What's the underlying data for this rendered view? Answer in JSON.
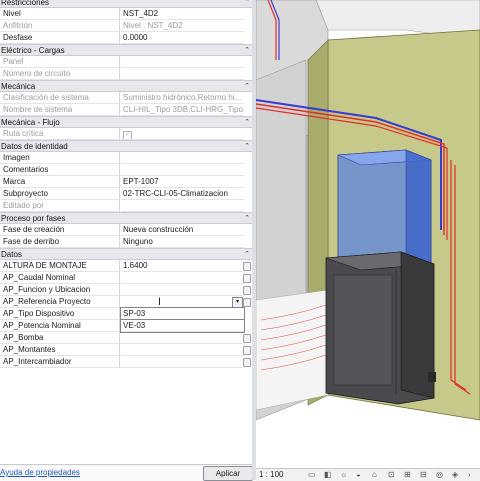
{
  "properties": {
    "groups": [
      {
        "name": "Restricciones",
        "rows": [
          {
            "label": "Nivel",
            "value": "NST_4D2",
            "disabled": false
          },
          {
            "label": "Anfitrión",
            "value": "Nivel : NST_4D2",
            "disabled": true
          },
          {
            "label": "Desfase",
            "value": "0.0000",
            "disabled": false
          }
        ]
      },
      {
        "name": "Eléctrico - Cargas",
        "rows": [
          {
            "label": "Panel",
            "value": "",
            "disabled": true
          },
          {
            "label": "Número de circuito",
            "value": "",
            "disabled": true
          }
        ]
      },
      {
        "name": "Mecánica",
        "rows": [
          {
            "label": "Clasificación de sistema",
            "value": "Suministro hidrónico,Retorno hi...",
            "disabled": true
          },
          {
            "label": "Nombre de sistema",
            "value": "CLI-HIL_Tipo 3DB,CLI-HRG_Tipo...",
            "disabled": true
          }
        ]
      },
      {
        "name": "Mecánica - Flujo",
        "rows": [
          {
            "label": "Ruta crítica",
            "value": "",
            "disabled": true,
            "checkbox": true
          }
        ]
      },
      {
        "name": "Datos de identidad",
        "rows": [
          {
            "label": "Imagen",
            "value": "",
            "disabled": false
          },
          {
            "label": "Comentarios",
            "value": "",
            "disabled": false
          },
          {
            "label": "Marca",
            "value": "EPT-1007",
            "disabled": false
          },
          {
            "label": "Subproyecto",
            "value": "02-TRC-CLI-05-Climatizacion",
            "disabled": false
          },
          {
            "label": "Editado por",
            "value": "",
            "disabled": true
          }
        ]
      },
      {
        "name": "Proceso por fases",
        "rows": [
          {
            "label": "Fase de creación",
            "value": "Nueva construcción",
            "disabled": false
          },
          {
            "label": "Fase de derribo",
            "value": "Ninguno",
            "disabled": false
          }
        ]
      },
      {
        "name": "Datos",
        "rows": [
          {
            "label": "ALTURA DE MONTAJE",
            "value": "1.6400",
            "disabled": false
          },
          {
            "label": "AP_Caudal Nominal",
            "value": "",
            "disabled": false
          },
          {
            "label": "AP_Funcion y Ubicacion",
            "value": "",
            "disabled": false
          },
          {
            "label": "AP_Referencia Proyecto",
            "value": "",
            "disabled": false,
            "dropdown": true
          },
          {
            "label": "AP_Tipo Dispositivo",
            "value": "SP-03",
            "disabled": false,
            "editing": true
          },
          {
            "label": "AP_Potencia Nominal",
            "value": "VE-03",
            "disabled": false,
            "editing": true
          },
          {
            "label": "AP_Bomba",
            "value": "",
            "disabled": false
          },
          {
            "label": "AP_Montantes",
            "value": "",
            "disabled": false
          },
          {
            "label": "AP_Intercambiador",
            "value": "",
            "disabled": false
          }
        ]
      }
    ],
    "collapse_icon": "chevron-up-double",
    "help_link": "Ayuda de propiedades",
    "apply_label": "Aplicar"
  },
  "view": {
    "scale": "1 : 100",
    "colors": {
      "wall": "#c7c98a",
      "cabinet": "#4a4a4e",
      "blue_unit": "#5b84e0",
      "pipe_red": "#e0302c",
      "pipe_blue": "#3a3ad0"
    }
  }
}
